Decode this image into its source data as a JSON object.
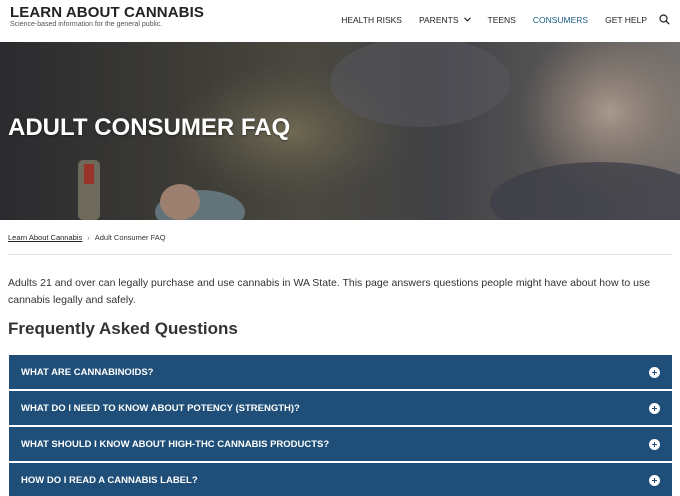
{
  "site": {
    "title": "LEARN ABOUT CANNABIS",
    "tagline": "Science-based information for the general public."
  },
  "nav": {
    "items": [
      {
        "label": "HEALTH RISKS"
      },
      {
        "label": "PARENTS"
      },
      {
        "label": "TEENS"
      },
      {
        "label": "CONSUMERS"
      },
      {
        "label": "GET HELP"
      }
    ],
    "active": "CONSUMERS",
    "search_icon": "search-icon"
  },
  "hero": {
    "title": "ADULT CONSUMER FAQ"
  },
  "breadcrumb": {
    "home": "Learn About Cannabis",
    "separator": "›",
    "current": "Adult Consumer FAQ"
  },
  "intro": "Adults 21 and over can legally purchase and use cannabis in WA State. This page answers questions people might have about how to use cannabis legally and safely.",
  "faq": {
    "heading": "Frequently Asked Questions",
    "items": [
      {
        "question": "WHAT ARE CANNABINOIDS?"
      },
      {
        "question": "WHAT DO I NEED TO KNOW ABOUT POTENCY (STRENGTH)?"
      },
      {
        "question": "WHAT SHOULD I KNOW ABOUT HIGH-THC CANNABIS PRODUCTS?"
      },
      {
        "question": "HOW DO I READ A CANNABIS LABEL?"
      }
    ]
  },
  "colors": {
    "accent": "#1f4f78",
    "nav_active": "#1b5e83"
  }
}
